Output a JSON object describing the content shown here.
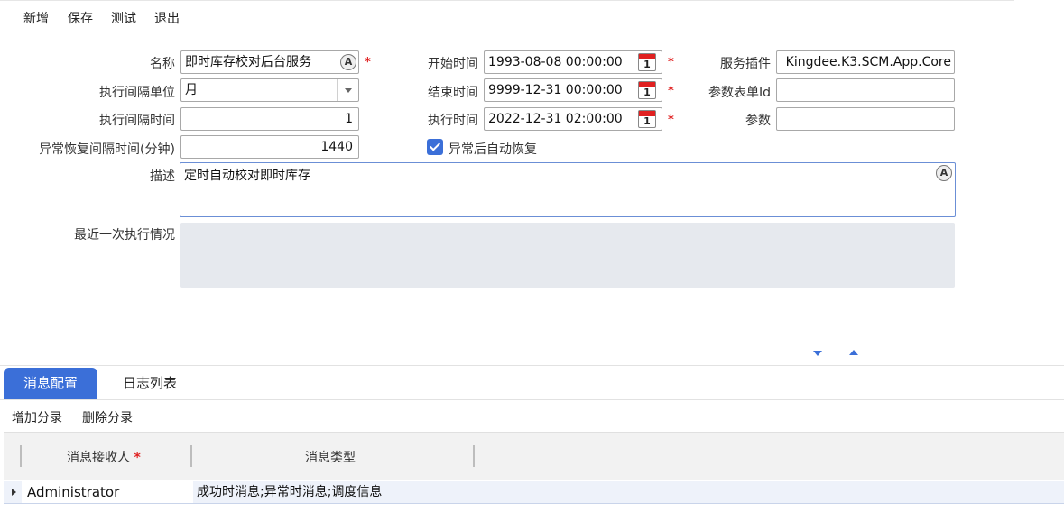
{
  "toolbar": {
    "new_label": "新增",
    "save_label": "保存",
    "test_label": "测试",
    "exit_label": "退出"
  },
  "form": {
    "name": {
      "label": "名称",
      "value": "即时库存校对后台服务",
      "lang_icon": "A"
    },
    "interval_unit": {
      "label": "执行间隔单位",
      "value": "月"
    },
    "interval_time": {
      "label": "执行间隔时间",
      "value": "1"
    },
    "recovery_interval": {
      "label": "异常恢复间隔时间(分钟)",
      "value": "1440"
    },
    "start_time": {
      "label": "开始时间",
      "value": "1993-08-08 00:00:00"
    },
    "end_time": {
      "label": "结束时间",
      "value": "9999-12-31 00:00:00"
    },
    "exec_time": {
      "label": "执行时间",
      "value": "2022-12-31 02:00:00"
    },
    "auto_recover": {
      "label": "异常后自动恢复",
      "checked": true
    },
    "service_plugin": {
      "label": "服务插件",
      "value": "Kingdee.K3.SCM.App.Core"
    },
    "param_form_id": {
      "label": "参数表单Id",
      "value": ""
    },
    "params": {
      "label": "参数",
      "value": ""
    },
    "description": {
      "label": "描述",
      "value": "定时自动校对即时库存",
      "lang_icon": "A"
    },
    "last_run": {
      "label": "最近一次执行情况",
      "value": ""
    },
    "required_mark": "*",
    "calendar_day": "1"
  },
  "tabs": [
    {
      "label": "消息配置",
      "active": true
    },
    {
      "label": "日志列表",
      "active": false
    }
  ],
  "entry_toolbar": {
    "add_label": "增加分录",
    "delete_label": "删除分录"
  },
  "grid": {
    "columns": [
      "消息接收人",
      "消息类型"
    ],
    "rows": [
      {
        "receiver": "Administrator",
        "types": "成功时消息;异常时消息;调度信息"
      }
    ]
  },
  "colors": {
    "accent": "#3b6fd8",
    "required": "#e02020",
    "readonly_bg": "#e6e9ee"
  }
}
